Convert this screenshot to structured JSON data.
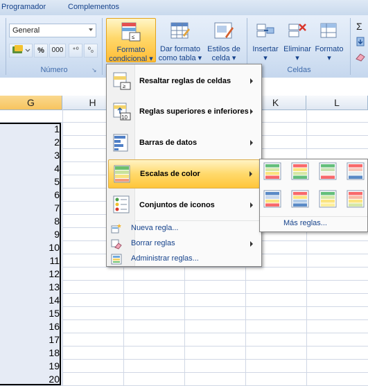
{
  "ribbon": {
    "tabs": [
      "Programador",
      "Complementos"
    ],
    "number_format": "General",
    "number_group_label": "Número",
    "cells_group_label": "Celdas",
    "buttons": {
      "conditional_format": [
        "Formato",
        "condicional ▾"
      ],
      "format_as_table": [
        "Dar formato",
        "como tabla ▾"
      ],
      "cell_styles": [
        "Estilos de",
        "celda ▾"
      ],
      "insert": [
        "Insertar",
        "▾"
      ],
      "delete": [
        "Eliminar",
        "▾"
      ],
      "format": [
        "Formato",
        "▾"
      ]
    },
    "small_buttons": {
      "percent": "%",
      "thousands": "000",
      "inc_decimals": "⁺⁰",
      "dec_decimals": "⁰₀"
    }
  },
  "sheet": {
    "columns": [
      "G",
      "H",
      "I",
      "J",
      "K",
      "L"
    ],
    "selected_column": "G",
    "values": [
      "1",
      "2",
      "3",
      "4",
      "5",
      "6",
      "7",
      "8",
      "9",
      "10",
      "11",
      "12",
      "13",
      "14",
      "15",
      "16",
      "17",
      "18",
      "19",
      "20"
    ]
  },
  "menu": {
    "items": [
      {
        "label": "Resaltar reglas de celdas",
        "icon": "highlight-rules-icon",
        "submenu": true
      },
      {
        "label": "Reglas superiores e inferiores",
        "icon": "top-bottom-rules-icon",
        "submenu": true
      },
      {
        "label": "Barras de datos",
        "icon": "data-bars-icon",
        "submenu": true
      },
      {
        "label": "Escalas de color",
        "icon": "color-scales-icon",
        "submenu": true,
        "highlighted": true
      },
      {
        "label": "Conjuntos de iconos",
        "icon": "icon-sets-icon",
        "submenu": true
      }
    ],
    "small_items": [
      {
        "label": "Nueva regla...",
        "icon": "new-rule-icon",
        "submenu": false
      },
      {
        "label": "Borrar reglas",
        "icon": "clear-rules-icon",
        "submenu": true
      },
      {
        "label": "Administrar reglas...",
        "icon": "manage-rules-icon",
        "submenu": false
      }
    ]
  },
  "submenu": {
    "more_rules": "Más reglas...",
    "accent": "#ffd96b"
  }
}
